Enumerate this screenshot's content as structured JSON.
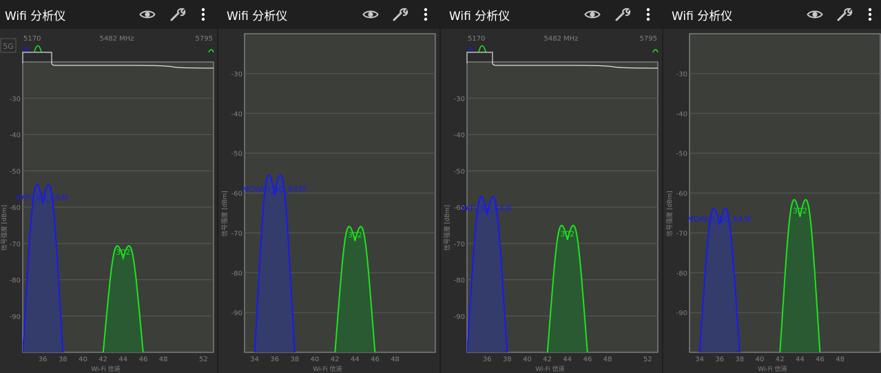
{
  "app": {
    "title": "Wifi 分析仪",
    "icons": [
      "eye-icon",
      "wrench-icon",
      "more-vert-icon"
    ]
  },
  "colors": {
    "panel_bg": "#2b2b2b",
    "plot_bg": "#3c3e3a",
    "grid": "#595c55",
    "axis_text": "#808080",
    "series_blue": "#1a1af0",
    "series_green": "#1ee31e",
    "fill_blue": "#333c6b",
    "fill_green": "#2a5a32"
  },
  "chart_data": [
    {
      "type": "area",
      "ylabel": "信号强度 [dBm]",
      "xlabel": "Wi-Fi 信道",
      "ylim": [
        -100,
        -20
      ],
      "xlim": [
        34,
        53
      ],
      "yticks": [
        -30,
        -40,
        -50,
        -60,
        -70,
        -80,
        -90
      ],
      "xticks": [
        36,
        38,
        40,
        42,
        44,
        46,
        48,
        52
      ],
      "band_label": "5G",
      "overview": {
        "labels": [
          "5170",
          "5482 MHz",
          "5795"
        ]
      },
      "series": [
        {
          "name": "WiFi_5G_E43F",
          "label": "WiFi_5G_E43F",
          "channel": 36,
          "peak_dbm": -59,
          "color": "blue"
        },
        {
          "name": "302",
          "label": "302",
          "channel": 44,
          "peak_dbm": -74,
          "color": "green"
        }
      ]
    },
    {
      "type": "area",
      "ylabel": "信号强度 [dBm]",
      "xlabel": "Wi-Fi 信道",
      "ylim": [
        -100,
        -20
      ],
      "xlim": [
        33,
        52
      ],
      "yticks": [
        -30,
        -40,
        -50,
        -60,
        -70,
        -80,
        -90
      ],
      "xticks": [
        34,
        36,
        38,
        40,
        42,
        44,
        46,
        48
      ],
      "series": [
        {
          "name": "MOWiFi_5G_E43F",
          "label": "MOWiFi_5G_E43F",
          "channel": 36,
          "peak_dbm": -60.5,
          "color": "blue"
        },
        {
          "name": "302",
          "label": "302",
          "channel": 44,
          "peak_dbm": -72,
          "color": "green"
        }
      ]
    },
    {
      "type": "area",
      "ylabel": "信号强度 [dBm]",
      "xlabel": "Wi-Fi 信道",
      "ylim": [
        -100,
        -20
      ],
      "xlim": [
        34,
        53
      ],
      "yticks": [
        -30,
        -40,
        -50,
        -60,
        -70,
        -80,
        -90
      ],
      "xticks": [
        36,
        38,
        40,
        42,
        44,
        46,
        48,
        52
      ],
      "band_label": "",
      "overview": {
        "labels": [
          "5170",
          "5482 MHz",
          "5795"
        ]
      },
      "series": [
        {
          "name": "WiFi_5G_E43F",
          "label": "WiFi_5G_E43F",
          "channel": 36,
          "peak_dbm": -62,
          "color": "blue"
        },
        {
          "name": "302",
          "label": "302",
          "channel": 44,
          "peak_dbm": -69,
          "color": "green"
        }
      ]
    },
    {
      "type": "area",
      "ylabel": "信号强度 [dBm]",
      "xlabel": "Wi-Fi 信道",
      "ylim": [
        -100,
        -20
      ],
      "xlim": [
        33,
        52
      ],
      "yticks": [
        -30,
        -40,
        -50,
        -60,
        -70,
        -80,
        -90
      ],
      "xticks": [
        34,
        36,
        38,
        40,
        42,
        44,
        46,
        48
      ],
      "series": [
        {
          "name": "MOWiFi_5G_E43F",
          "label": "MOWiFi_5G_E43F",
          "channel": 36,
          "peak_dbm": -68,
          "color": "blue"
        },
        {
          "name": "302",
          "label": "302",
          "channel": 44,
          "peak_dbm": -66,
          "color": "green"
        }
      ]
    }
  ]
}
